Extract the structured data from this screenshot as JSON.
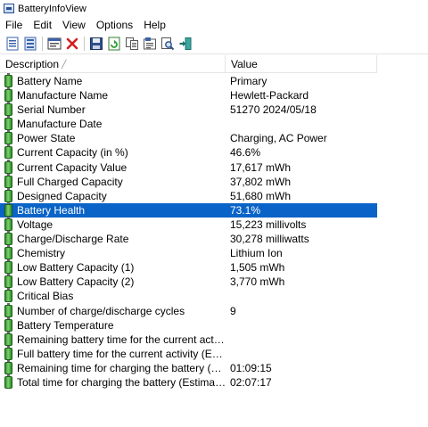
{
  "window": {
    "title": "BatteryInfoView"
  },
  "menu": [
    "File",
    "Edit",
    "View",
    "Options",
    "Help"
  ],
  "toolbar": {
    "buttons": [
      "properties-icon",
      "report-icon",
      "sep",
      "advanced-options-icon",
      "delete-icon",
      "sep",
      "save-icon",
      "refresh-icon",
      "copy-icon",
      "html-report-icon",
      "find-icon",
      "exit-icon"
    ]
  },
  "columns": {
    "description": "Description",
    "value": "Value"
  },
  "rows": [
    {
      "description": "Battery Name",
      "value": "Primary"
    },
    {
      "description": "Manufacture Name",
      "value": "Hewlett-Packard"
    },
    {
      "description": "Serial Number",
      "value": "51270 2024/05/18"
    },
    {
      "description": "Manufacture Date",
      "value": ""
    },
    {
      "description": "Power State",
      "value": "Charging, AC Power"
    },
    {
      "description": "Current Capacity (in %)",
      "value": "46.6%"
    },
    {
      "description": "Current Capacity Value",
      "value": "17,617 mWh"
    },
    {
      "description": "Full Charged Capacity",
      "value": "37,802 mWh"
    },
    {
      "description": "Designed Capacity",
      "value": "51,680 mWh"
    },
    {
      "description": "Battery Health",
      "value": "73.1%",
      "selected": true
    },
    {
      "description": "Voltage",
      "value": "15,223 millivolts"
    },
    {
      "description": "Charge/Discharge Rate",
      "value": "30,278 milliwatts"
    },
    {
      "description": "Chemistry",
      "value": "Lithium Ion"
    },
    {
      "description": "Low Battery Capacity (1)",
      "value": "1,505 mWh"
    },
    {
      "description": "Low Battery Capacity (2)",
      "value": "3,770 mWh"
    },
    {
      "description": "Critical Bias",
      "value": ""
    },
    {
      "description": "Number of charge/discharge cycles",
      "value": "9"
    },
    {
      "description": "Battery Temperature",
      "value": ""
    },
    {
      "description": "Remaining battery time for the current activity (Est...",
      "value": ""
    },
    {
      "description": "Full battery time for the current activity (Estimated)",
      "value": ""
    },
    {
      "description": "Remaining time for charging the battery (Estimated)",
      "value": "01:09:15"
    },
    {
      "description": "Total  time for charging the battery (Estimated)",
      "value": "02:07:17"
    }
  ],
  "colors": {
    "selection": "#0a63c7",
    "battery_green": "#2e8b2e"
  }
}
